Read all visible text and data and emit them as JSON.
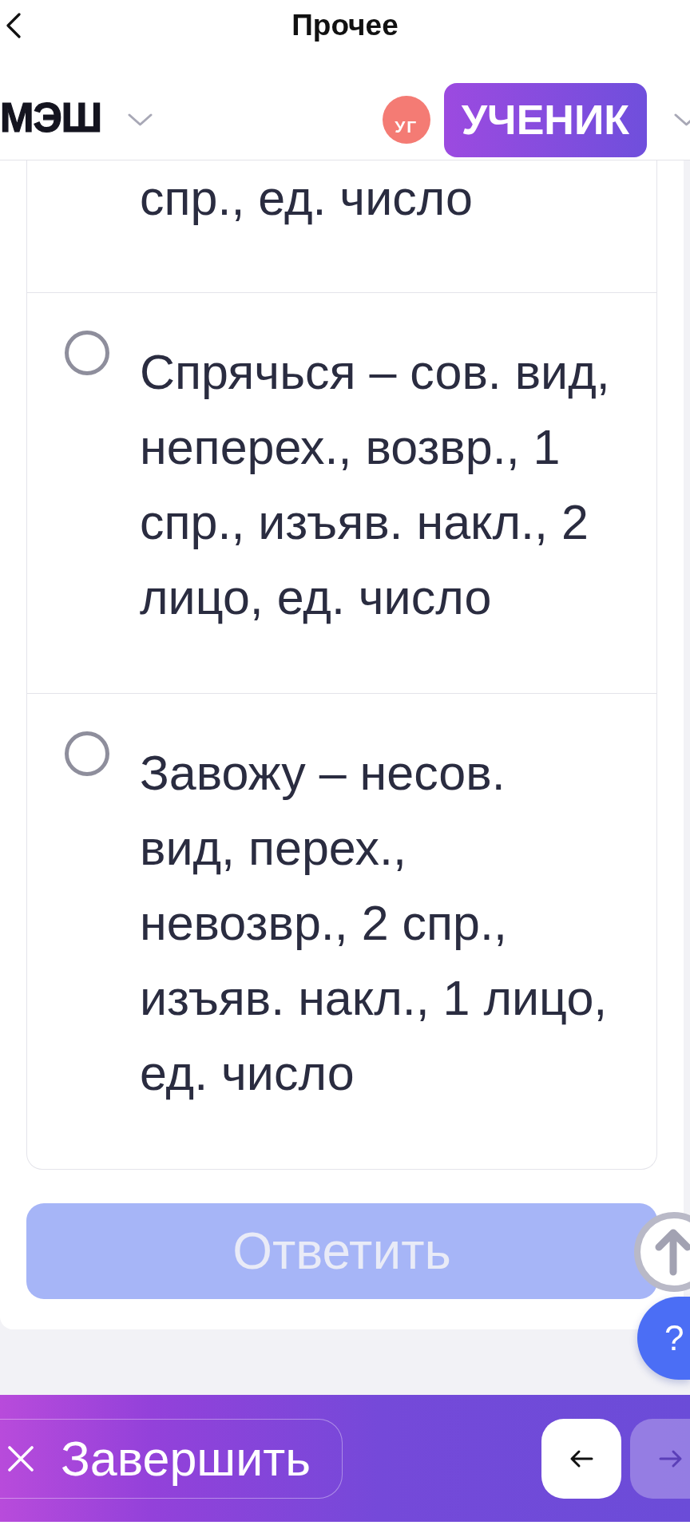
{
  "nav": {
    "title": "Прочее"
  },
  "header": {
    "logo": "МЭШ",
    "avatar": {
      "initials": "УГ"
    },
    "role_badge": "УЧЕНИК"
  },
  "question": {
    "scrolled_option_tail": "спр., ед. число",
    "options": [
      {
        "text": "Спрячься – сов. вид, неперех., возвр., 1 спр., изъяв. накл., 2 лицо, ед. число",
        "selected": false
      },
      {
        "text": "Завожу – несов. вид, перех., невозвр., 2 спр., изъяв. накл., 1 лицо, ед. число",
        "selected": false
      }
    ]
  },
  "answer_button": {
    "label": "Ответить",
    "disabled": true
  },
  "help_button": {
    "label": "?"
  },
  "bottom_bar": {
    "finish_button": {
      "label": "Завершить"
    },
    "nav_buttons": [
      {
        "kind": "prev",
        "disabled": false
      },
      {
        "kind": "next",
        "disabled": true
      }
    ]
  }
}
